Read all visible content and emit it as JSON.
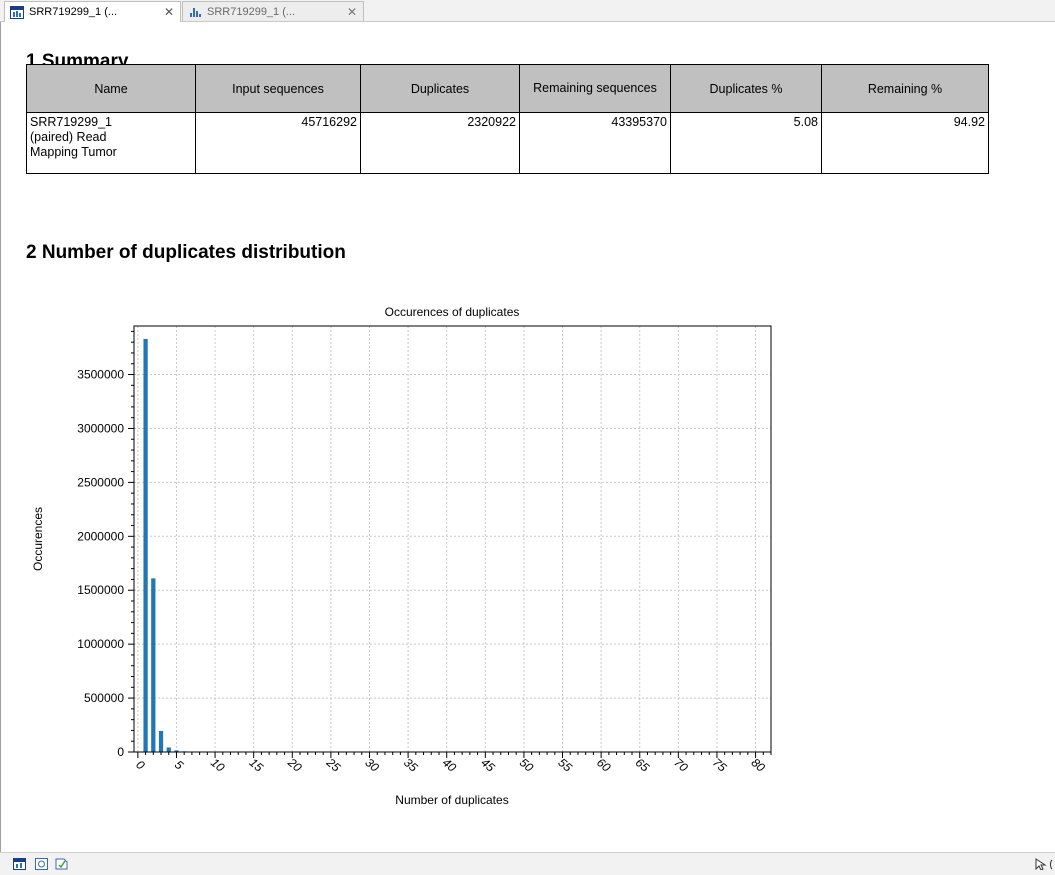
{
  "tabs": [
    {
      "label": "SRR719299_1 (...",
      "icon": "table-report-icon",
      "active": true
    },
    {
      "label": "SRR719299_1 (...",
      "icon": "bar-chart-icon",
      "active": false
    }
  ],
  "section1": {
    "title": "1 Summary"
  },
  "summary": {
    "headers": [
      "Name",
      "Input sequences",
      "Duplicates",
      "Remaining sequences",
      "Duplicates %",
      "Remaining %"
    ],
    "rows": [
      {
        "name": "SRR719299_1 (paired) Read Mapping Tumor",
        "input": "45716292",
        "duplicates": "2320922",
        "remaining": "43395370",
        "dup_pct": "5.08",
        "rem_pct": "94.92"
      }
    ]
  },
  "section2": {
    "title": "2 Number of duplicates distribution"
  },
  "chart_data": {
    "type": "bar",
    "title": "Occurences of duplicates",
    "xlabel": "Number of duplicates",
    "ylabel": "Occurences",
    "xlim": [
      -0.5,
      82
    ],
    "ylim": [
      0,
      3950000
    ],
    "xticks": [
      0,
      5,
      10,
      15,
      20,
      25,
      30,
      35,
      40,
      45,
      50,
      55,
      60,
      65,
      70,
      75,
      80
    ],
    "yticks": [
      0,
      500000,
      1000000,
      1500000,
      2000000,
      2500000,
      3000000,
      3500000
    ],
    "grid": true,
    "x": [
      1,
      2,
      3,
      4,
      5,
      6
    ],
    "values": [
      3830000,
      1610000,
      195000,
      42000,
      15000,
      6000
    ],
    "bar_color": "#1f77b4"
  },
  "statusbar": {
    "icons": [
      "table-view-icon",
      "settings-view-icon",
      "history-view-icon"
    ]
  }
}
